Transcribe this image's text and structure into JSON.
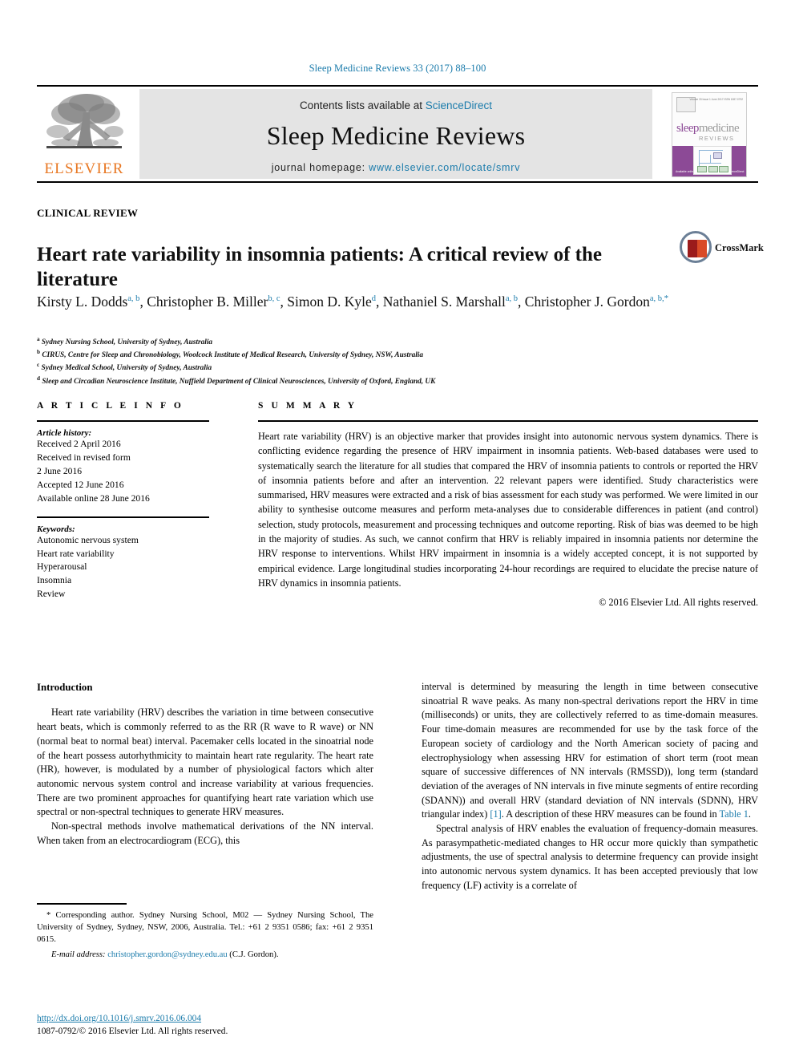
{
  "running_head": "Sleep Medicine Reviews 33 (2017) 88–100",
  "masthead": {
    "contents_prefix": "Contents lists available at ",
    "contents_link": "ScienceDirect",
    "journal_name": "Sleep Medicine Reviews",
    "homepage_prefix": "journal homepage: ",
    "homepage_link": "www.elsevier.com/locate/smrv",
    "publisher_logo_word": "ELSEVIER",
    "cover": {
      "title_part1": "sleep",
      "title_part2": "medicine",
      "subtitle": "REVIEWS",
      "issn_line": "Volume 33  Issue 1  June 2017  ISSN 1087-0792",
      "footer_line": "Available online at\nwww.sciencedirect.com\nScienceDirect"
    }
  },
  "article": {
    "type_label": "CLINICAL REVIEW",
    "title": "Heart rate variability in insomnia patients: A critical review of the literature",
    "crossmark_label": "CrossMark",
    "authors": [
      {
        "name": "Kirsty L. Dodds",
        "marks": "a, b",
        "sep": ", "
      },
      {
        "name": "Christopher B. Miller",
        "marks": "b, c",
        "sep": ", "
      },
      {
        "name": "Simon D. Kyle",
        "marks": "d",
        "sep": ", "
      },
      {
        "name": "Nathaniel S. Marshall",
        "marks": "a, b",
        "sep": ", "
      },
      {
        "name": "Christopher J. Gordon",
        "marks": "a, b,",
        "star": "*",
        "sep": ""
      }
    ],
    "affiliations": [
      {
        "mark": "a",
        "text": "Sydney Nursing School, University of Sydney, Australia"
      },
      {
        "mark": "b",
        "text": "CIRUS, Centre for Sleep and Chronobiology, Woolcock Institute of Medical Research, University of Sydney, NSW, Australia"
      },
      {
        "mark": "c",
        "text": "Sydney Medical School, University of Sydney, Australia"
      },
      {
        "mark": "d",
        "text": "Sleep and Circadian Neuroscience Institute, Nuffield Department of Clinical Neurosciences, University of Oxford, England, UK"
      }
    ]
  },
  "article_info": {
    "heading": "A R T I C L E   I N F O",
    "history_label": "Article history:",
    "history": [
      "Received 2 April 2016",
      "Received in revised form",
      "2 June 2016",
      "Accepted 12 June 2016",
      "Available online 28 June 2016"
    ],
    "keywords_label": "Keywords:",
    "keywords": [
      "Autonomic nervous system",
      "Heart rate variability",
      "Hyperarousal",
      "Insomnia",
      "Review"
    ]
  },
  "summary": {
    "heading": "S U M M A R Y",
    "text": "Heart rate variability (HRV) is an objective marker that provides insight into autonomic nervous system dynamics. There is conflicting evidence regarding the presence of HRV impairment in insomnia patients. Web-based databases were used to systematically search the literature for all studies that compared the HRV of insomnia patients to controls or reported the HRV of insomnia patients before and after an intervention. 22 relevant papers were identified. Study characteristics were summarised, HRV measures were extracted and a risk of bias assessment for each study was performed. We were limited in our ability to synthesise outcome measures and perform meta-analyses due to considerable differences in patient (and control) selection, study protocols, measurement and processing techniques and outcome reporting. Risk of bias was deemed to be high in the majority of studies. As such, we cannot confirm that HRV is reliably impaired in insomnia patients nor determine the HRV response to interventions. Whilst HRV impairment in insomnia is a widely accepted concept, it is not supported by empirical evidence. Large longitudinal studies incorporating 24-hour recordings are required to elucidate the precise nature of HRV dynamics in insomnia patients.",
    "copyright": "© 2016 Elsevier Ltd. All rights reserved."
  },
  "body": {
    "heading": "Introduction",
    "left_paragraphs": [
      "Heart rate variability (HRV) describes the variation in time between consecutive heart beats, which is commonly referred to as the RR (R wave to R wave) or NN (normal beat to normal beat) interval. Pacemaker cells located in the sinoatrial node of the heart possess autorhythmicity to maintain heart rate regularity. The heart rate (HR), however, is modulated by a number of physiological factors which alter autonomic nervous system control and increase variability at various frequencies. There are two prominent approaches for quantifying heart rate variation which use spectral or non-spectral techniques to generate HRV measures.",
      "Non-spectral methods involve mathematical derivations of the NN interval. When taken from an electrocardiogram (ECG), this"
    ],
    "right_paragraph_1_a": "interval is determined by measuring the length in time between consecutive sinoatrial R wave peaks. As many non-spectral derivations report the HRV in time (milliseconds) or units, they are collectively referred to as time-domain measures. Four time-domain measures are recommended for use by the task force of the European society of cardiology and the North American society of pacing and electrophysiology when assessing HRV for estimation of short term (root mean square of successive differences of NN intervals (RMSSD)), long term (standard deviation of the averages of NN intervals in five minute segments of entire recording (SDANN)) and overall HRV (standard deviation of NN intervals (SDNN), HRV triangular index) ",
    "right_ref_1": "[1]",
    "right_paragraph_1_b": ". A description of these HRV measures can be found in ",
    "right_ref_table": "Table 1",
    "right_paragraph_1_c": ".",
    "right_paragraph_2": "Spectral analysis of HRV enables the evaluation of frequency-domain measures. As parasympathetic-mediated changes to HR occur more quickly than sympathetic adjustments, the use of spectral analysis to determine frequency can provide insight into autonomic nervous system dynamics. It has been accepted previously that low frequency (LF) activity is a correlate of"
  },
  "footnotes": {
    "corresponding": "* Corresponding author. Sydney Nursing School, M02 — Sydney Nursing School, The University of Sydney, Sydney, NSW, 2006, Australia. Tel.: +61 2 9351 0586; fax: +61 2 9351 0615.",
    "email_label": "E-mail address:",
    "email": "christopher.gordon@sydney.edu.au",
    "email_suffix": " (C.J. Gordon).",
    "doi": "http://dx.doi.org/10.1016/j.smrv.2016.06.004",
    "issn_line": "1087-0792/© 2016 Elsevier Ltd. All rights reserved."
  },
  "colors": {
    "link": "#1a7bab",
    "elsevier_orange": "#e87722",
    "cover_purple": "#8c4a96"
  }
}
